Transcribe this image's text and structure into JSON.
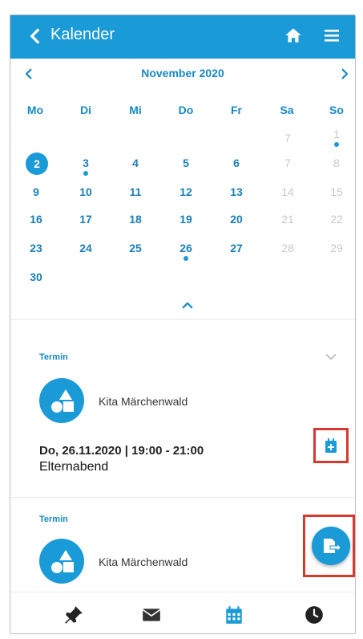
{
  "app_bar": {
    "title": "Kalender"
  },
  "calendar": {
    "month_label": "November 2020",
    "weekdays": [
      "Mo",
      "Di",
      "Mi",
      "Do",
      "Fr",
      "Sa",
      "So"
    ],
    "selected_day": "2",
    "days_with_events": [
      "1",
      "3",
      "26"
    ],
    "weeks": [
      [
        "",
        "",
        "",
        "",
        "",
        "7",
        "1"
      ],
      [
        "2",
        "3",
        "4",
        "5",
        "6",
        "7",
        "8"
      ],
      [
        "9",
        "10",
        "11",
        "12",
        "13",
        "14",
        "15"
      ],
      [
        "16",
        "17",
        "18",
        "19",
        "20",
        "21",
        "22"
      ],
      [
        "23",
        "24",
        "25",
        "26",
        "27",
        "28",
        "29"
      ],
      [
        "30",
        "",
        "",
        "",
        "",
        "",
        ""
      ]
    ]
  },
  "events": [
    {
      "type_label": "Termin",
      "organization": "Kita Märchenwald",
      "datetime": "Do, 26.11.2020 | 19:00 - 21:00",
      "title": "Elternabend"
    },
    {
      "type_label": "Termin",
      "organization": "Kita Märchenwald"
    }
  ],
  "colors": {
    "primary": "#1a9ad6",
    "highlight_border": "#d63a2f"
  },
  "bottom_nav": {
    "active": "calendar",
    "items": [
      "pin-icon",
      "mail-icon",
      "calendar-icon",
      "clock-icon"
    ]
  }
}
